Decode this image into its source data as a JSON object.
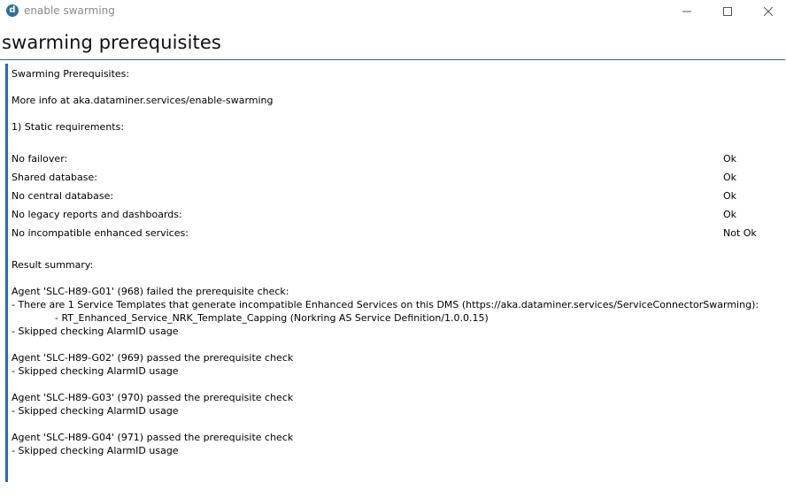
{
  "window": {
    "app_icon_letter": "d",
    "title": "enable swarming",
    "minimize_symbol": "—",
    "maximize_symbol": "☐",
    "close_symbol": "✕"
  },
  "header": {
    "title": "swarming prerequisites"
  },
  "content": {
    "heading": "Swarming Prerequisites:",
    "more_info": "More info at aka.dataminer.services/enable-swarming",
    "static_requirements_label": "1) Static requirements:",
    "requirements": [
      {
        "label": "No failover:",
        "status": "Ok"
      },
      {
        "label": "Shared database:",
        "status": "Ok"
      },
      {
        "label": "No central database:",
        "status": "Ok"
      },
      {
        "label": "No legacy reports and dashboards:",
        "status": "Ok"
      },
      {
        "label": "No incompatible enhanced services:",
        "status": "Not Ok"
      }
    ],
    "result_summary_label": "Result summary:",
    "agents": [
      {
        "line": "Agent 'SLC-H89-G01' (968) failed the prerequisite check:",
        "detail1": "- There are 1 Service Templates that generate incompatible Enhanced Services on this DMS (https://aka.dataminer.services/ServiceConnectorSwarming):",
        "detail2": "- RT_Enhanced_Service_NRK_Template_Capping (Norkring AS Service Definition/1.0.0.15)",
        "detail3": "- Skipped checking AlarmID usage"
      },
      {
        "line": "Agent 'SLC-H89-G02' (969) passed the prerequisite check",
        "detail1": "- Skipped checking AlarmID usage"
      },
      {
        "line": "Agent 'SLC-H89-G03' (970) passed the prerequisite check",
        "detail1": "- Skipped checking AlarmID usage"
      },
      {
        "line": "Agent 'SLC-H89-G04' (971) passed the prerequisite check",
        "detail1": "- Skipped checking AlarmID usage"
      }
    ]
  }
}
